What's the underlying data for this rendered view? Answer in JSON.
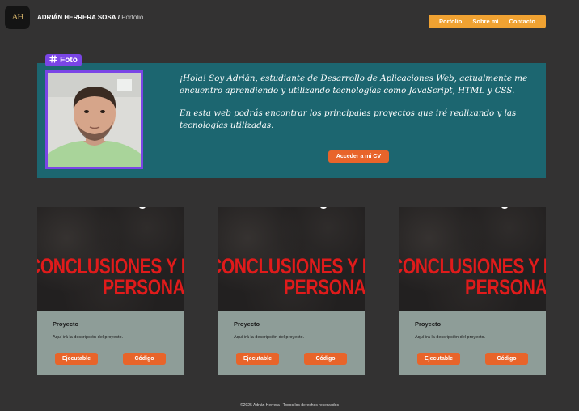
{
  "header": {
    "logo_text": "AH",
    "name": "ADRIÁN HERRERA SOSA",
    "separator": "/",
    "subtitle": "Porfolio"
  },
  "nav": {
    "items": [
      {
        "label": "Porfolio"
      },
      {
        "label": "Sobre mí"
      },
      {
        "label": "Contacto"
      }
    ]
  },
  "intro": {
    "badge": "Foto",
    "paragraph1": "¡Hola! Soy Adrián, estudiante de Desarrollo de Aplicaciones Web, actualmente me encuentro aprendiendo y utilizando tecnologías como JavaScript, HTML y CSS.",
    "paragraph2": "En esta web podrás encontrar los principales proyectos que iré realizando y las tecnologías utilizadas.",
    "cv_button": "Acceder a mi CV"
  },
  "projects": [
    {
      "thumb_line1": "CONCLUSIONES Y EVA",
      "thumb_line2": "PERSONAL",
      "title": "Proyecto",
      "description": "Aquí irá la descripción del proyecto.",
      "exec_label": "Ejecutable",
      "code_label": "Código"
    },
    {
      "thumb_line1": "CONCLUSIONES Y EVA",
      "thumb_line2": "PERSONAL",
      "title": "Proyecto",
      "description": "Aquí irá la descripción del proyecto.",
      "exec_label": "Ejecutable",
      "code_label": "Código"
    },
    {
      "thumb_line1": "CONCLUSIONES Y EVA",
      "thumb_line2": "PERSONAL",
      "title": "Proyecto",
      "description": "Aquí irá la descripción del proyecto.",
      "exec_label": "Ejecutable",
      "code_label": "Código"
    }
  ],
  "footer": {
    "text": "©2025 Adrián Herrera | Todos los derechos reservados"
  },
  "colors": {
    "background": "#333232",
    "accent_orange": "#f0a232",
    "button_orange": "#e8642a",
    "intro_teal": "#1c6670",
    "photo_border": "#7a45e6",
    "card_bg": "#8e9d98",
    "thumb_red": "#e01b1b"
  },
  "icons": {
    "badge_icon": "hash-icon"
  }
}
